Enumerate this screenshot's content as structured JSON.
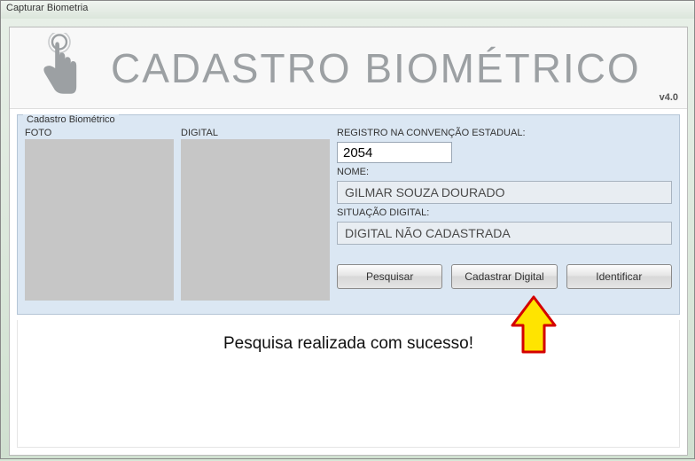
{
  "window": {
    "title": "Capturar Biometria"
  },
  "header": {
    "title": "CADASTRO BIOMÉTRICO",
    "version": "v4.0"
  },
  "groupbox": {
    "legend": "Cadastro Biométrico",
    "foto_label": "FOTO",
    "digital_label": "DIGITAL"
  },
  "fields": {
    "registro_label": "REGISTRO NA CONVENÇÃO ESTADUAL:",
    "registro_value": "2054",
    "nome_label": "NOME:",
    "nome_value": "GILMAR SOUZA DOURADO",
    "situacao_label": "SITUAÇÃO DIGITAL:",
    "situacao_value": "DIGITAL NÃO CADASTRADA"
  },
  "buttons": {
    "pesquisar": "Pesquisar",
    "cadastrar": "Cadastrar Digital",
    "identificar": "Identificar"
  },
  "status": {
    "message": "Pesquisa realizada com sucesso!"
  }
}
